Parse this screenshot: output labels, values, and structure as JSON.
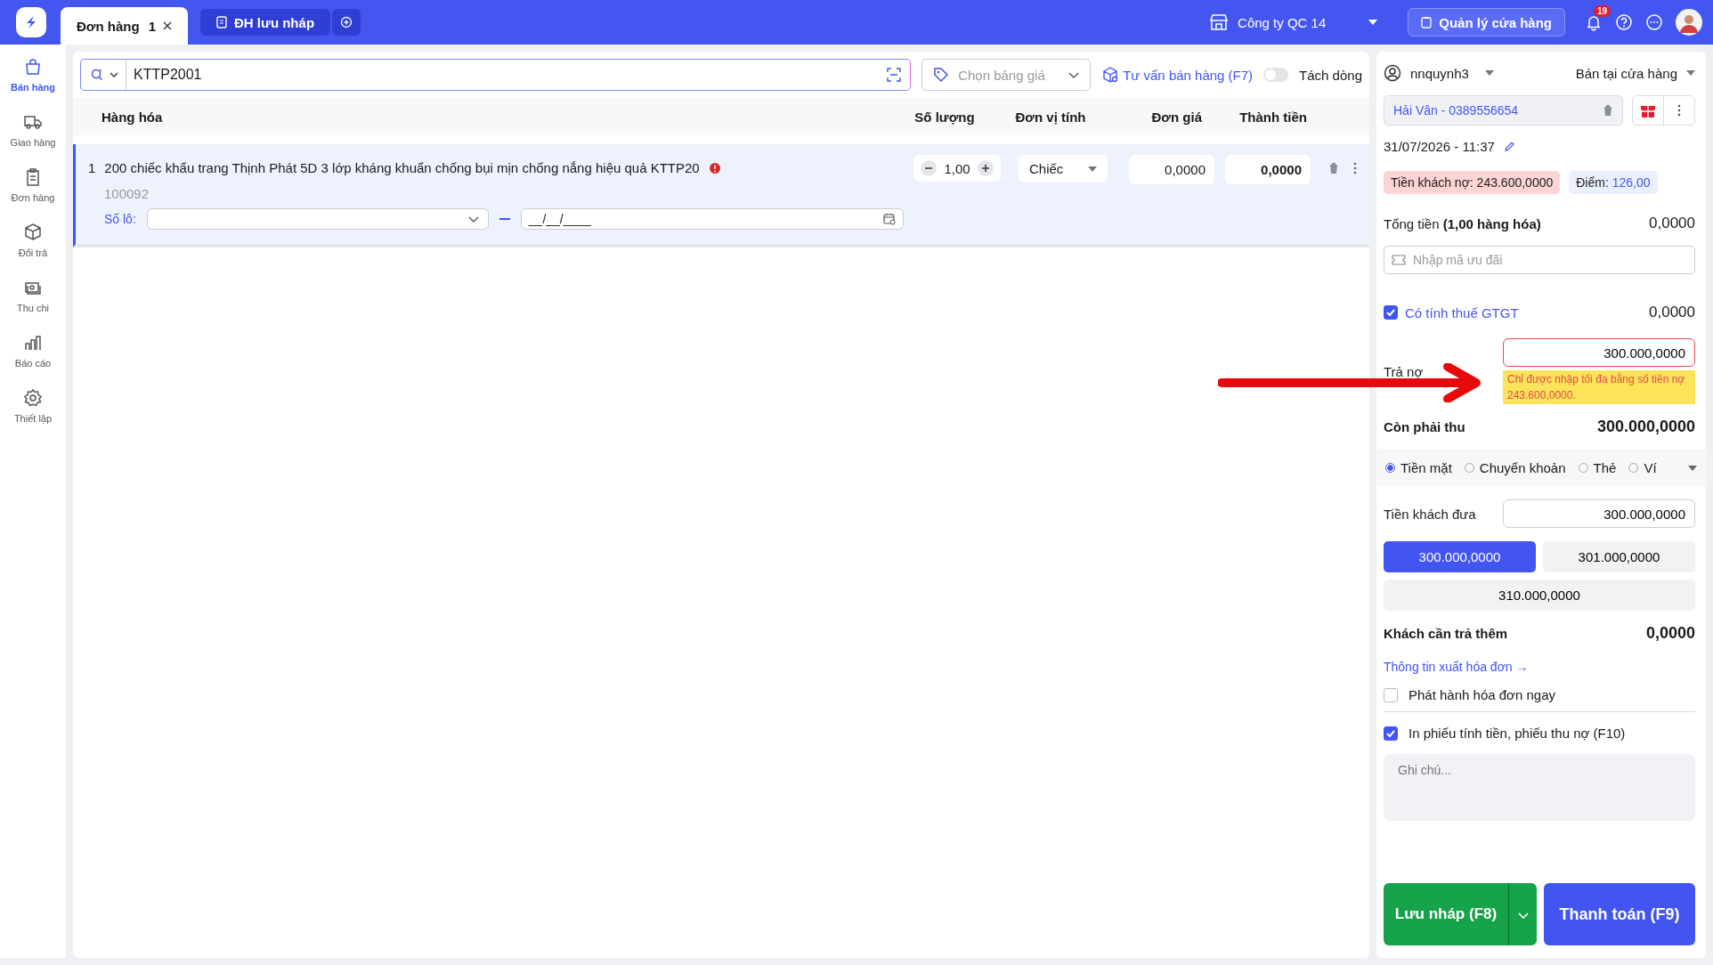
{
  "tabs": [
    {
      "kind": "order",
      "label": "Đơn hàng",
      "count": "1",
      "selected": true
    },
    {
      "kind": "draft",
      "label": "ĐH lưu nháp",
      "selected": false
    }
  ],
  "header": {
    "store": "Công ty QC 14",
    "manage_button": "Quản lý cửa hàng",
    "notification_count": "19"
  },
  "sidebar": {
    "items": [
      {
        "kind": "bag",
        "label": "Bán hàng",
        "selected": true
      },
      {
        "kind": "truck",
        "label": "Giao hàng",
        "selected": false
      },
      {
        "kind": "clipboard",
        "label": "Đơn hàng",
        "selected": false
      },
      {
        "kind": "box",
        "label": "Đổi trả",
        "selected": false
      },
      {
        "kind": "cash",
        "label": "Thu chi",
        "selected": false
      },
      {
        "kind": "chart",
        "label": "Báo cáo",
        "selected": false
      },
      {
        "kind": "gear",
        "label": "Thiết lập",
        "selected": false
      }
    ]
  },
  "search": {
    "value": "KTTP2001"
  },
  "price_list": {
    "placeholder": "Chọn bảng giá"
  },
  "advisor_link": "Tư vấn bán hàng (F7)",
  "split_toggle": {
    "label": "Tách dòng",
    "on": false
  },
  "table": {
    "columns": [
      "Hàng hóa",
      "Số lượng",
      "Đơn vị tính",
      "Đơn giá",
      "Thành tiền"
    ],
    "rows": [
      {
        "index": "1",
        "name": "200 chiếc khẩu trang Thịnh Phát 5D 3 lớp kháng khuẩn chống bụi mịn chống nắng hiệu quả KTTP20",
        "code": "100092",
        "quantity": "1,00",
        "unit": "Chiếc",
        "price": "0,0000",
        "total": "0,0000",
        "lot_label": "Số lô:",
        "expiry_placeholder": "__/__/____"
      }
    ]
  },
  "order_panel": {
    "seller": "nnquynh3",
    "sale_channel": "Bán tại cửa hàng",
    "customer": "Hải Vân - 0389556654",
    "datetime": "31/07/2026 - 11:37",
    "debt_label": "Tiền khách nợ:",
    "debt_value": "243.600,0000",
    "points_label": "Điểm:",
    "points_value": "126,00",
    "total_label": "Tổng tiền **(1,00 hàng hóa)**",
    "total_value": "0,0000",
    "promo_placeholder": "Nhập mã ưu đãi",
    "vat": {
      "label": "Có tính thuế GTGT",
      "checked": true,
      "value": "0,0000"
    },
    "debt_payment": {
      "label": "Trả nợ",
      "value": "300.000,0000",
      "error": "Chỉ được nhập tối đa bằng số tiền nợ 243.600,0000."
    },
    "remaining_label": "Còn phải thu",
    "remaining_value": "300.000,0000",
    "payment_methods": [
      {
        "label": "Tiền mặt",
        "selected": true
      },
      {
        "label": "Chuyển khoản",
        "selected": false
      },
      {
        "label": "Thẻ",
        "selected": false
      },
      {
        "label": "Ví",
        "selected": false
      }
    ],
    "paid_label": "Tiền khách đưa",
    "paid_value": "300.000,0000",
    "quick_amounts": [
      {
        "label": "300.000,0000",
        "selected": true
      },
      {
        "label": "301.000,0000",
        "selected": false
      },
      {
        "label": "310.000,0000",
        "selected": false
      }
    ],
    "change_label": "Khách cần trả thêm",
    "change_value": "0,0000",
    "invoice_link": "Thông tin xuất hóa đơn →",
    "options": [
      {
        "label": "Phát hành hóa đơn ngay",
        "checked": false
      },
      {
        "label": "In phiếu tính tiền, phiếu thu nợ (F10)",
        "checked": true
      }
    ],
    "note_placeholder": "Ghi chú...",
    "save_button": "Lưu nháp (F8)",
    "pay_button": "Thanh toán (F9)"
  }
}
